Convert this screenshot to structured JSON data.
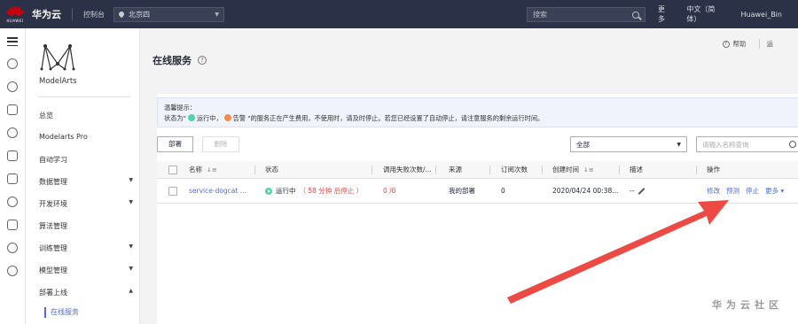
{
  "topbar": {
    "brand_mark": "HUAWEI",
    "brand": "华为云",
    "console": "控制台",
    "region": "北京四",
    "search_placeholder": "搜索",
    "links": [
      "更多",
      "中文（简体）",
      "Huawei_Bin"
    ]
  },
  "sidenav": {
    "product": "ModelArts",
    "items": [
      {
        "label": "总览",
        "arrow": ""
      },
      {
        "label": "Modelarts Pro",
        "arrow": ""
      },
      {
        "label": "自动学习",
        "arrow": ""
      },
      {
        "label": "数据管理",
        "arrow": "▼"
      },
      {
        "label": "开发环境",
        "arrow": "▼"
      },
      {
        "label": "算法管理",
        "arrow": ""
      },
      {
        "label": "训练管理",
        "arrow": "▼"
      },
      {
        "label": "模型管理",
        "arrow": "▼"
      },
      {
        "label": "部署上线",
        "arrow": "▲"
      }
    ],
    "active_sub": "在线服务"
  },
  "header": {
    "help": "帮助",
    "more": "运",
    "title": "在线服务",
    "title_help_icon": "?"
  },
  "tip": {
    "line1": "温馨提示：",
    "line2_a": "状态为\"",
    "line2_b": "运行中，",
    "line2_c": "告警 \"的服务正在产生费用，不使用时，请及时停止。若您已经设置了自动停止，请注意服务的剩余运行时间。"
  },
  "toolbar": {
    "deploy": "部署",
    "delete": "删除",
    "filter_select": "全部",
    "filter_placeholder": "请输入名称查询"
  },
  "table": {
    "headers": [
      "名称",
      "状态",
      "调用失败次数/...",
      "来源",
      "订阅次数",
      "创建时间",
      "描述",
      "操作"
    ],
    "rows": [
      {
        "name": "service-dogcat ...",
        "status": "运行中",
        "status_note": "（ 58 分钟 后停止 ）",
        "calls": "0 /0",
        "source": "我的部署",
        "subs": "0",
        "created": "2020/04/24 00:38...",
        "desc": "--",
        "actions": [
          "修改",
          "预测",
          "停止",
          "更多 ▾"
        ]
      }
    ]
  },
  "watermark": "华为云社区",
  "colors": {
    "topbar": "#2b3147",
    "accent": "#526ecc",
    "running": "#50d4ab",
    "alert": "#f58c4a",
    "arrow": "#ee4a44"
  }
}
